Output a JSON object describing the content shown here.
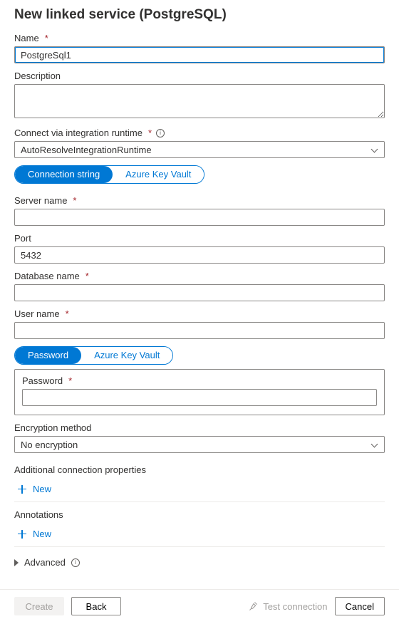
{
  "header": {
    "title": "New linked service (PostgreSQL)"
  },
  "name": {
    "label": "Name",
    "required": true,
    "value": "PostgreSql1"
  },
  "description": {
    "label": "Description",
    "value": ""
  },
  "runtime": {
    "label": "Connect via integration runtime",
    "required": true,
    "selected": "AutoResolveIntegrationRuntime"
  },
  "auth_method": {
    "options": [
      "Connection string",
      "Azure Key Vault"
    ],
    "active_index": 0
  },
  "server": {
    "label": "Server name",
    "required": true,
    "value": ""
  },
  "port": {
    "label": "Port",
    "value": "5432"
  },
  "database": {
    "label": "Database name",
    "required": true,
    "value": ""
  },
  "user": {
    "label": "User name",
    "required": true,
    "value": ""
  },
  "password_source": {
    "options": [
      "Password",
      "Azure Key Vault"
    ],
    "active_index": 0
  },
  "password": {
    "label": "Password",
    "required": true,
    "value": ""
  },
  "encryption": {
    "label": "Encryption method",
    "selected": "No encryption"
  },
  "additional_props": {
    "label": "Additional connection properties",
    "add_label": "New"
  },
  "annotations": {
    "label": "Annotations",
    "add_label": "New"
  },
  "advanced": {
    "label": "Advanced"
  },
  "footer": {
    "create": "Create",
    "back": "Back",
    "test": "Test connection",
    "cancel": "Cancel"
  }
}
